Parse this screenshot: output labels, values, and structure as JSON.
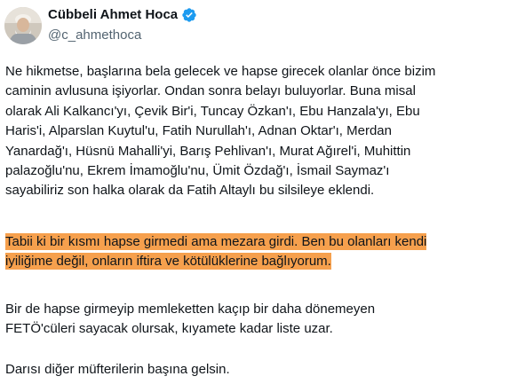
{
  "author": {
    "display_name": "Cübbeli Ahmet Hoca",
    "handle": "@c_ahmethoca",
    "verified_icon": "verified-badge-icon",
    "verified_color": "#1d9bf0"
  },
  "tweet": {
    "paragraph_1": "Ne hikmetse, başlarına bela gelecek ve hapse girecek olanlar önce bizim\ncaminin avlusuna işiyorlar. Ondan sonra belayı buluyorlar. Buna misal\nolarak Ali Kalkancı'yı, Çevik Bir'i, Tuncay Özkan'ı, Ebu Hanzala'yı, Ebu\nHaris'i, Alparslan Kuytul'u, Fatih Nurullah'ı, Adnan Oktar'ı, Merdan\nYanardağ'ı, Hüsnü Mahalli'yi, Barış Pehlivan'ı, Murat Ağırel'i, Muhittin\npalazoğlu'nu, Ekrem İmamoğlu'nu, Ümit Özdağ'ı, İsmail Saymaz'ı\nsayabiliriz son halka olarak da Fatih Altaylı bu silsileye eklendi.",
    "paragraph_2_highlighted": "Tabii ki bir kısmı hapse girmedi ama mezara girdi. Ben bu olanları kendi\niyiliğime değil, onların iftira ve kötülüklerine bağlıyorum.",
    "highlight_color": "#f6a04d",
    "paragraph_3": "Bir de hapse girmeyip memleketten kaçıp bir daha dönemeyen\nFETÖ'cüleri sayacak olursak, kıyamete kadar liste uzar.",
    "paragraph_4": "Darısı diğer müfterilerin başına gelsin."
  }
}
